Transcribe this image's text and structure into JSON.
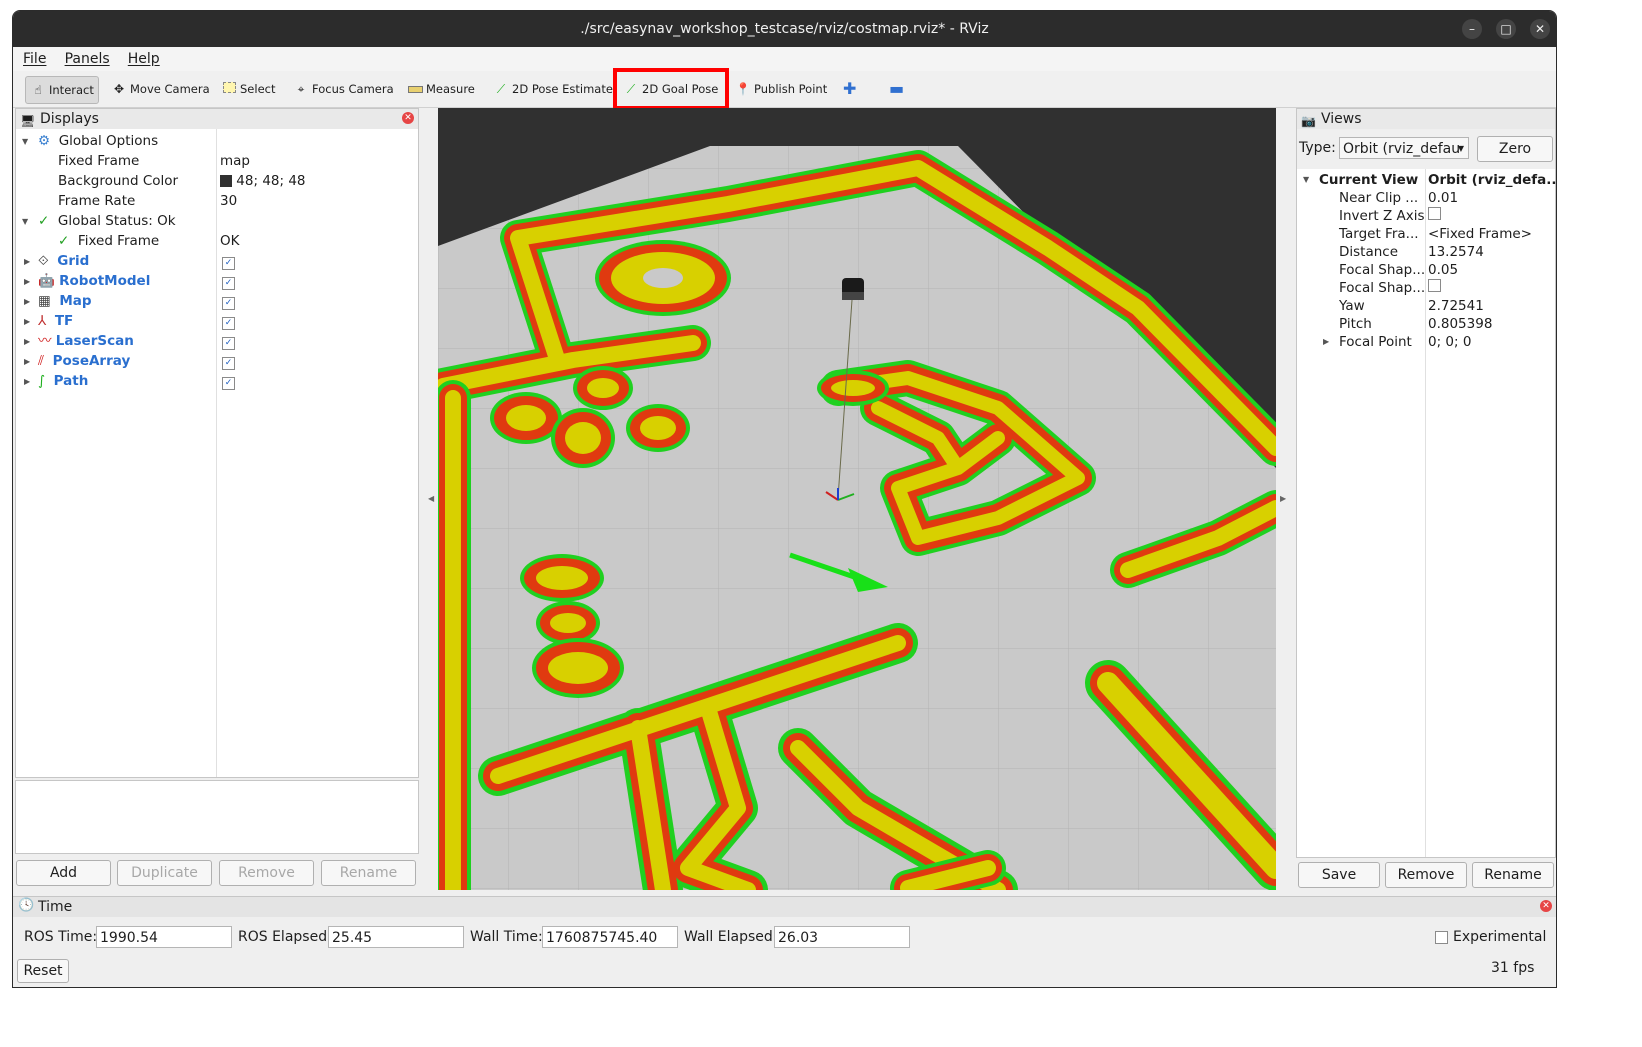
{
  "window": {
    "title": "./src/easynav_workshop_testcase/rviz/costmap.rviz* - RViz"
  },
  "menu": [
    "File",
    "Panels",
    "Help"
  ],
  "toolbar": {
    "interact": "Interact",
    "move_camera": "Move Camera",
    "select": "Select",
    "focus_camera": "Focus Camera",
    "measure": "Measure",
    "pose_estimate": "2D Pose Estimate",
    "goal_pose": "2D Goal Pose",
    "publish_point": "Publish Point"
  },
  "displays": {
    "title": "Displays",
    "global_options": "Global Options",
    "fixed_frame_label": "Fixed Frame",
    "fixed_frame_value": "map",
    "background_color_label": "Background Color",
    "background_color_value": "48; 48; 48",
    "frame_rate_label": "Frame Rate",
    "frame_rate_value": "30",
    "global_status": "Global Status: Ok",
    "status_fixed_frame": "Fixed Frame",
    "status_fixed_frame_value": "OK",
    "items": [
      "Grid",
      "RobotModel",
      "Map",
      "TF",
      "LaserScan",
      "PoseArray",
      "Path"
    ],
    "buttons": {
      "add": "Add",
      "duplicate": "Duplicate",
      "remove": "Remove",
      "rename": "Rename"
    }
  },
  "views": {
    "title": "Views",
    "type_label": "Type:",
    "type_value": "Orbit (rviz_defau",
    "zero": "Zero",
    "current_view": "Current View",
    "current_view_value": "Orbit (rviz_defa...",
    "props": [
      {
        "k": "Near Clip ...",
        "v": "0.01"
      },
      {
        "k": "Invert Z Axis",
        "v": ""
      },
      {
        "k": "Target Fra...",
        "v": "<Fixed Frame>"
      },
      {
        "k": "Distance",
        "v": "13.2574"
      },
      {
        "k": "Focal Shap...",
        "v": "0.05"
      },
      {
        "k": "Focal Shap...",
        "v": ""
      },
      {
        "k": "Yaw",
        "v": "2.72541"
      },
      {
        "k": "Pitch",
        "v": "0.805398"
      },
      {
        "k": "Focal Point",
        "v": "0; 0; 0"
      }
    ],
    "buttons": {
      "save": "Save",
      "remove": "Remove",
      "rename": "Rename"
    }
  },
  "time": {
    "title": "Time",
    "ros_time_label": "ROS Time:",
    "ros_time": "1990.54",
    "ros_elapsed_label": "ROS Elapsed:",
    "ros_elapsed": "25.45",
    "wall_time_label": "Wall Time:",
    "wall_time": "1760875745.40",
    "wall_elapsed_label": "Wall Elapsed:",
    "wall_elapsed": "26.03",
    "experimental": "Experimental",
    "reset": "Reset",
    "fps": "31 fps"
  },
  "colors": {
    "accent_highlight": "#ff0000",
    "costmap_yellow": "#d8d000",
    "costmap_red": "#e03a10",
    "costmap_green": "#22dd22",
    "floor": "#c8c8c8",
    "background": "#303030"
  }
}
